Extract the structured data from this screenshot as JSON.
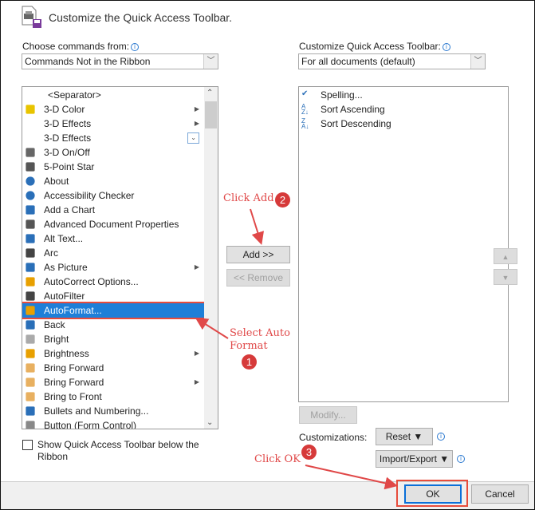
{
  "dialog": {
    "title": "Customize the Quick Access Toolbar."
  },
  "left": {
    "label": "Choose commands from:",
    "selected": "Commands Not in the Ribbon",
    "items": [
      {
        "label": "<Separator>",
        "icon": "none"
      },
      {
        "label": "3-D Color",
        "icon": "paint-bucket-icon",
        "submenu": true
      },
      {
        "label": "3-D Effects",
        "icon": "none",
        "submenu": true
      },
      {
        "label": "3-D Effects",
        "icon": "none",
        "dropdown": true
      },
      {
        "label": "3-D On/Off",
        "icon": "3d-icon"
      },
      {
        "label": "5-Point Star",
        "icon": "star-icon"
      },
      {
        "label": "About",
        "icon": "help-icon"
      },
      {
        "label": "Accessibility Checker",
        "icon": "accessibility-icon"
      },
      {
        "label": "Add a Chart",
        "icon": "chart-icon"
      },
      {
        "label": "Advanced Document Properties",
        "icon": "properties-icon"
      },
      {
        "label": "Alt Text...",
        "icon": "alt-text-icon"
      },
      {
        "label": "Arc",
        "icon": "arc-icon"
      },
      {
        "label": "As Picture",
        "icon": "picture-icon",
        "submenu": true
      },
      {
        "label": "AutoCorrect Options...",
        "icon": "lightning-icon"
      },
      {
        "label": "AutoFilter",
        "icon": "filter-icon"
      },
      {
        "label": "AutoFormat...",
        "icon": "autoformat-icon",
        "selected": true
      },
      {
        "label": "Back",
        "icon": "back-arrow-icon"
      },
      {
        "label": "Bright",
        "icon": "cube-icon"
      },
      {
        "label": "Brightness",
        "icon": "sun-icon",
        "submenu": true
      },
      {
        "label": "Bring Forward",
        "icon": "bring-forward-icon"
      },
      {
        "label": "Bring Forward",
        "icon": "bring-forward-icon",
        "split": true
      },
      {
        "label": "Bring to Front",
        "icon": "bring-front-icon"
      },
      {
        "label": "Bullets and Numbering...",
        "icon": "bullets-icon"
      },
      {
        "label": "Button (Form Control)",
        "icon": "button-icon"
      }
    ],
    "show_below_label": "Show Quick Access Toolbar below the Ribbon",
    "show_below_checked": false
  },
  "right": {
    "label": "Customize Quick Access Toolbar:",
    "selected": "For all documents (default)",
    "items": [
      {
        "label": "Spelling...",
        "icon": "spelling-icon"
      },
      {
        "label": "Sort Ascending",
        "icon": "sort-ascending-icon"
      },
      {
        "label": "Sort Descending",
        "icon": "sort-descending-icon"
      }
    ],
    "modify": "Modify...",
    "customizations": "Customizations:",
    "reset": "Reset ▼",
    "import_export": "Import/Export ▼"
  },
  "buttons": {
    "add": "Add >>",
    "remove": "<< Remove",
    "ok": "OK",
    "cancel": "Cancel"
  },
  "annotations": {
    "step1": "Select Auto Format",
    "n1": "1",
    "step2": "Click Add",
    "n2": "2",
    "step3": "Click OK",
    "n3": "3"
  },
  "colors": {
    "selection": "#1e7fd8",
    "annotation": "#e04848",
    "highlight_box": "#e74c3c"
  }
}
